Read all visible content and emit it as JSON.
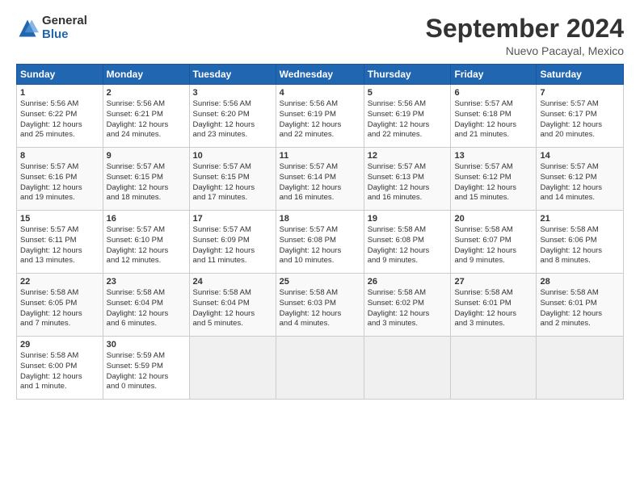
{
  "logo": {
    "general": "General",
    "blue": "Blue"
  },
  "title": "September 2024",
  "subtitle": "Nuevo Pacayal, Mexico",
  "columns": [
    "Sunday",
    "Monday",
    "Tuesday",
    "Wednesday",
    "Thursday",
    "Friday",
    "Saturday"
  ],
  "weeks": [
    [
      {
        "day": 1,
        "lines": [
          "Sunrise: 5:56 AM",
          "Sunset: 6:22 PM",
          "Daylight: 12 hours",
          "and 25 minutes."
        ]
      },
      {
        "day": 2,
        "lines": [
          "Sunrise: 5:56 AM",
          "Sunset: 6:21 PM",
          "Daylight: 12 hours",
          "and 24 minutes."
        ]
      },
      {
        "day": 3,
        "lines": [
          "Sunrise: 5:56 AM",
          "Sunset: 6:20 PM",
          "Daylight: 12 hours",
          "and 23 minutes."
        ]
      },
      {
        "day": 4,
        "lines": [
          "Sunrise: 5:56 AM",
          "Sunset: 6:19 PM",
          "Daylight: 12 hours",
          "and 22 minutes."
        ]
      },
      {
        "day": 5,
        "lines": [
          "Sunrise: 5:56 AM",
          "Sunset: 6:19 PM",
          "Daylight: 12 hours",
          "and 22 minutes."
        ]
      },
      {
        "day": 6,
        "lines": [
          "Sunrise: 5:57 AM",
          "Sunset: 6:18 PM",
          "Daylight: 12 hours",
          "and 21 minutes."
        ]
      },
      {
        "day": 7,
        "lines": [
          "Sunrise: 5:57 AM",
          "Sunset: 6:17 PM",
          "Daylight: 12 hours",
          "and 20 minutes."
        ]
      }
    ],
    [
      {
        "day": 8,
        "lines": [
          "Sunrise: 5:57 AM",
          "Sunset: 6:16 PM",
          "Daylight: 12 hours",
          "and 19 minutes."
        ]
      },
      {
        "day": 9,
        "lines": [
          "Sunrise: 5:57 AM",
          "Sunset: 6:15 PM",
          "Daylight: 12 hours",
          "and 18 minutes."
        ]
      },
      {
        "day": 10,
        "lines": [
          "Sunrise: 5:57 AM",
          "Sunset: 6:15 PM",
          "Daylight: 12 hours",
          "and 17 minutes."
        ]
      },
      {
        "day": 11,
        "lines": [
          "Sunrise: 5:57 AM",
          "Sunset: 6:14 PM",
          "Daylight: 12 hours",
          "and 16 minutes."
        ]
      },
      {
        "day": 12,
        "lines": [
          "Sunrise: 5:57 AM",
          "Sunset: 6:13 PM",
          "Daylight: 12 hours",
          "and 16 minutes."
        ]
      },
      {
        "day": 13,
        "lines": [
          "Sunrise: 5:57 AM",
          "Sunset: 6:12 PM",
          "Daylight: 12 hours",
          "and 15 minutes."
        ]
      },
      {
        "day": 14,
        "lines": [
          "Sunrise: 5:57 AM",
          "Sunset: 6:12 PM",
          "Daylight: 12 hours",
          "and 14 minutes."
        ]
      }
    ],
    [
      {
        "day": 15,
        "lines": [
          "Sunrise: 5:57 AM",
          "Sunset: 6:11 PM",
          "Daylight: 12 hours",
          "and 13 minutes."
        ]
      },
      {
        "day": 16,
        "lines": [
          "Sunrise: 5:57 AM",
          "Sunset: 6:10 PM",
          "Daylight: 12 hours",
          "and 12 minutes."
        ]
      },
      {
        "day": 17,
        "lines": [
          "Sunrise: 5:57 AM",
          "Sunset: 6:09 PM",
          "Daylight: 12 hours",
          "and 11 minutes."
        ]
      },
      {
        "day": 18,
        "lines": [
          "Sunrise: 5:57 AM",
          "Sunset: 6:08 PM",
          "Daylight: 12 hours",
          "and 10 minutes."
        ]
      },
      {
        "day": 19,
        "lines": [
          "Sunrise: 5:58 AM",
          "Sunset: 6:08 PM",
          "Daylight: 12 hours",
          "and 9 minutes."
        ]
      },
      {
        "day": 20,
        "lines": [
          "Sunrise: 5:58 AM",
          "Sunset: 6:07 PM",
          "Daylight: 12 hours",
          "and 9 minutes."
        ]
      },
      {
        "day": 21,
        "lines": [
          "Sunrise: 5:58 AM",
          "Sunset: 6:06 PM",
          "Daylight: 12 hours",
          "and 8 minutes."
        ]
      }
    ],
    [
      {
        "day": 22,
        "lines": [
          "Sunrise: 5:58 AM",
          "Sunset: 6:05 PM",
          "Daylight: 12 hours",
          "and 7 minutes."
        ]
      },
      {
        "day": 23,
        "lines": [
          "Sunrise: 5:58 AM",
          "Sunset: 6:04 PM",
          "Daylight: 12 hours",
          "and 6 minutes."
        ]
      },
      {
        "day": 24,
        "lines": [
          "Sunrise: 5:58 AM",
          "Sunset: 6:04 PM",
          "Daylight: 12 hours",
          "and 5 minutes."
        ]
      },
      {
        "day": 25,
        "lines": [
          "Sunrise: 5:58 AM",
          "Sunset: 6:03 PM",
          "Daylight: 12 hours",
          "and 4 minutes."
        ]
      },
      {
        "day": 26,
        "lines": [
          "Sunrise: 5:58 AM",
          "Sunset: 6:02 PM",
          "Daylight: 12 hours",
          "and 3 minutes."
        ]
      },
      {
        "day": 27,
        "lines": [
          "Sunrise: 5:58 AM",
          "Sunset: 6:01 PM",
          "Daylight: 12 hours",
          "and 3 minutes."
        ]
      },
      {
        "day": 28,
        "lines": [
          "Sunrise: 5:58 AM",
          "Sunset: 6:01 PM",
          "Daylight: 12 hours",
          "and 2 minutes."
        ]
      }
    ],
    [
      {
        "day": 29,
        "lines": [
          "Sunrise: 5:58 AM",
          "Sunset: 6:00 PM",
          "Daylight: 12 hours",
          "and 1 minute."
        ]
      },
      {
        "day": 30,
        "lines": [
          "Sunrise: 5:59 AM",
          "Sunset: 5:59 PM",
          "Daylight: 12 hours",
          "and 0 minutes."
        ]
      },
      null,
      null,
      null,
      null,
      null
    ]
  ]
}
